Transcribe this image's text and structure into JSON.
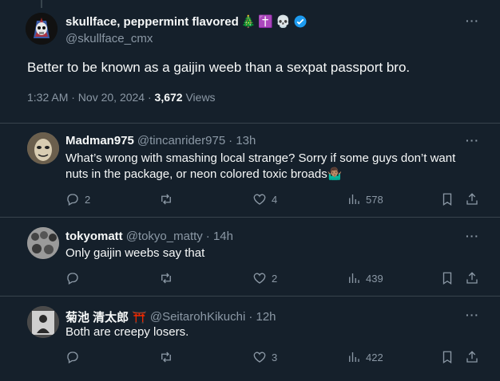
{
  "main_tweet": {
    "display_name": "skullface, peppermint flavored",
    "emoji": [
      "🎄",
      "✝️",
      "💀"
    ],
    "handle": "@skullface_cmx",
    "text": "Better to be known as a gaijin weeb than a sexpat passport bro.",
    "time": "1:32 AM · Nov 20, 2024 · ",
    "views_count": "3,672",
    "views_label": " Views",
    "more": "···"
  },
  "replies": [
    {
      "name": "Madman975",
      "handle": "@tincanrider975",
      "time": "· 13h",
      "text": "What’s wrong with smashing local strange? Sorry if some guys don’t want nuts in the package, or neon colored toxic broads🤷🏽‍♂️",
      "replies": "2",
      "reposts": "",
      "likes": "4",
      "views": "578",
      "more": "···"
    },
    {
      "name": "tokyomatt",
      "handle": "@tokyo_matty",
      "time": "· 14h",
      "text": "Only gaijin weebs say that",
      "replies": "",
      "reposts": "",
      "likes": "2",
      "views": "439",
      "more": "···"
    },
    {
      "name": "菊池 清太郎",
      "name_emoji": "⛩️",
      "handle": "@SeitarohKikuchi",
      "time": "· 12h",
      "text": "Both are creepy losers.",
      "replies": "",
      "reposts": "",
      "likes": "3",
      "views": "422",
      "more": "···"
    }
  ],
  "colors": {
    "background": "#15202b",
    "text": "#f7f9f9",
    "muted": "#8b98a5",
    "verified": "#1d9bf0",
    "border": "#38444d"
  }
}
